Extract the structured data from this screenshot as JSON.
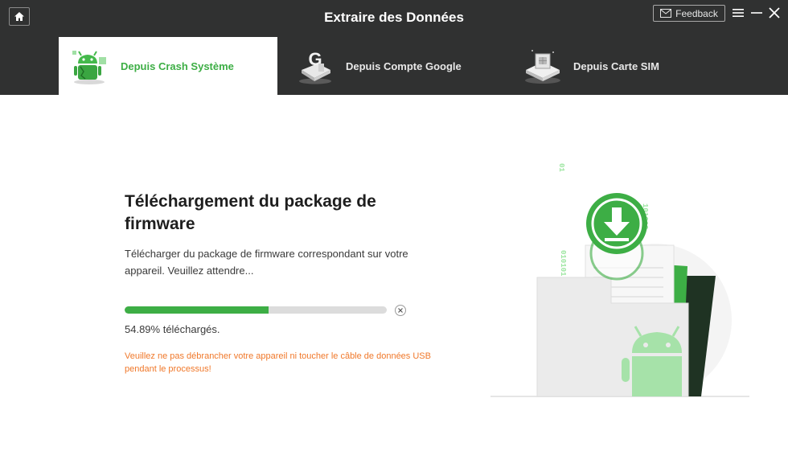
{
  "window": {
    "title": "Extraire des Données",
    "feedback_label": "Feedback",
    "home_icon": "home-icon",
    "menu_icon": "hamburger-menu-icon",
    "minimize_icon": "minimize-icon",
    "close_icon": "close-icon"
  },
  "tabs": [
    {
      "label": "Depuis Crash Système",
      "icon": "android-crash-icon",
      "active": true
    },
    {
      "label": "Depuis Compte Google",
      "icon": "google-account-icon",
      "active": false
    },
    {
      "label": "Depuis Carte SIM",
      "icon": "sim-card-icon",
      "active": false
    }
  ],
  "main": {
    "heading": "Téléchargement du package de firmware",
    "description": "Télécharger du package de firmware correspondant sur votre appareil. Veuillez attendre...",
    "progress": {
      "percent": 54.89,
      "text": "54.89% téléchargés."
    },
    "warning": "Veuillez ne pas débrancher votre appareil ni toucher le câble de données USB pendant le processus!",
    "illustration": {
      "binary_strings": [
        "01",
        "010101",
        "101010",
        "010101"
      ],
      "icons": [
        "download-circle-icon",
        "folder-icon",
        "android-robot-icon"
      ]
    }
  },
  "colors": {
    "header_bg": "#303131",
    "accent_green": "#3dae45",
    "warning_orange": "#f0782a",
    "progress_track": "#dcdcdc"
  }
}
